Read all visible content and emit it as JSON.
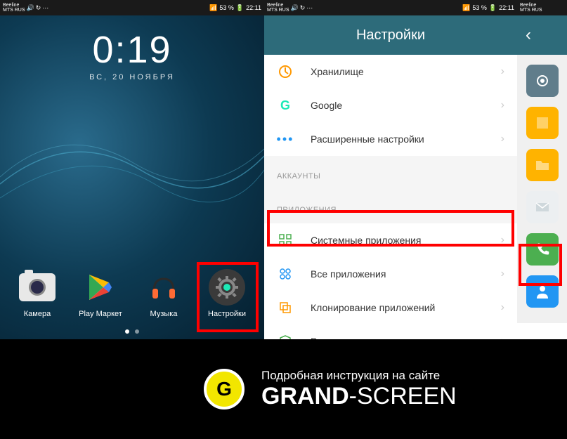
{
  "status": {
    "carrier_line1": "Beeline",
    "carrier_line2": "MTS RUS",
    "battery_pct": "53 %",
    "time": "22:11"
  },
  "home": {
    "clock_time": "0:19",
    "clock_date": "ВС, 20 НОЯБРЯ",
    "apps": [
      {
        "label": "Камера"
      },
      {
        "label": "Play Маркет"
      },
      {
        "label": "Музыка"
      },
      {
        "label": "Настройки"
      }
    ]
  },
  "settings": {
    "title": "Настройки",
    "section_accounts": "АККАУНТЫ",
    "section_apps": "ПРИЛОЖЕНИЯ",
    "items": {
      "storage": "Хранилище",
      "google": "Google",
      "advanced": "Расширенные настройки",
      "system_apps": "Системные приложения",
      "all_apps": "Все приложения",
      "cloning": "Клонирование приложений",
      "permissions": "Разрешения"
    }
  },
  "footer": {
    "top": "Подробная инструкция на сайте",
    "brand_bold": "GRAND",
    "brand_light": "-SCREEN",
    "logo_letter": "G"
  }
}
